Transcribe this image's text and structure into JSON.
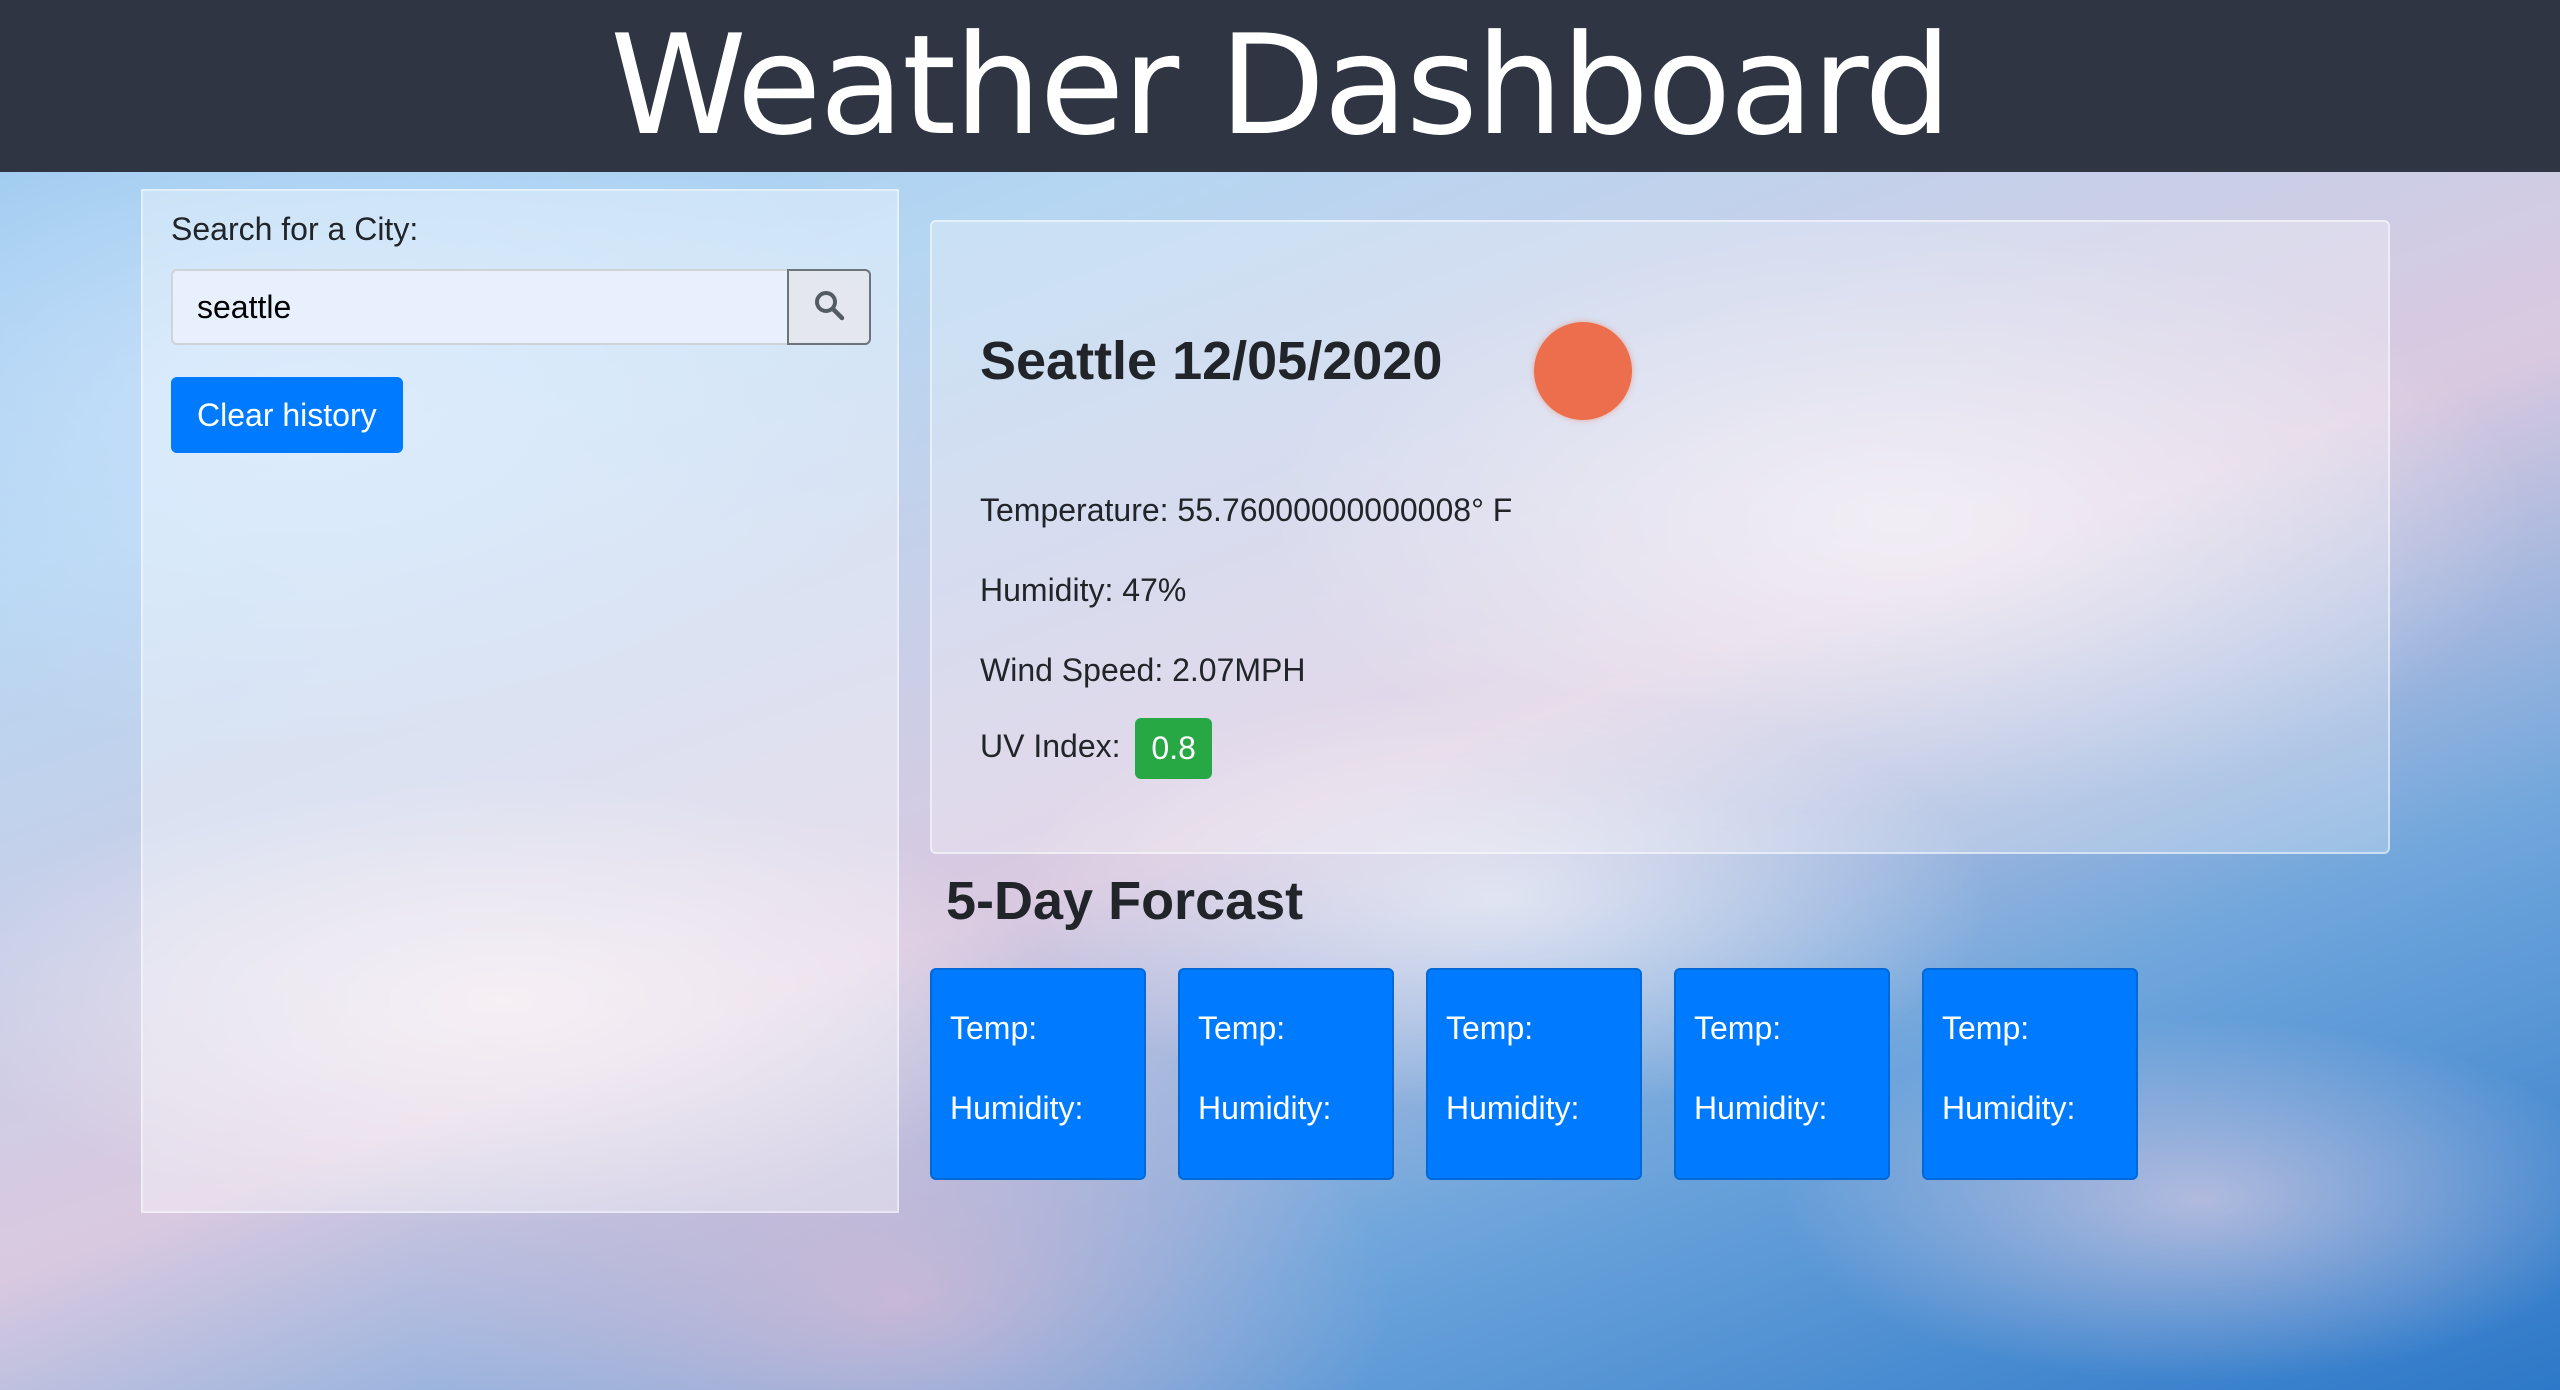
{
  "header": {
    "title": "Weather Dashboard"
  },
  "sidebar": {
    "search_label": "Search for a City:",
    "search_value": "seattle",
    "search_icon": "search-icon",
    "clear_label": "Clear history"
  },
  "current": {
    "city_date": "Seattle 12/05/2020",
    "weather_icon": "sun-icon",
    "temperature": "Temperature: 55.76000000000008° F",
    "humidity": "Humidity: 47%",
    "wind": "Wind Speed: 2.07MPH",
    "uv_label": "UV Index:",
    "uv_value": "0.8",
    "uv_color": "#28a745"
  },
  "forecast": {
    "title": "5-Day Forcast",
    "cards": [
      {
        "temp": "Temp:",
        "humidity": "Humidity:"
      },
      {
        "temp": "Temp:",
        "humidity": "Humidity:"
      },
      {
        "temp": "Temp:",
        "humidity": "Humidity:"
      },
      {
        "temp": "Temp:",
        "humidity": "Humidity:"
      },
      {
        "temp": "Temp:",
        "humidity": "Humidity:"
      }
    ]
  },
  "colors": {
    "header_bg": "#2f3542",
    "accent": "#007bff",
    "sun": "#ec6e4c"
  }
}
